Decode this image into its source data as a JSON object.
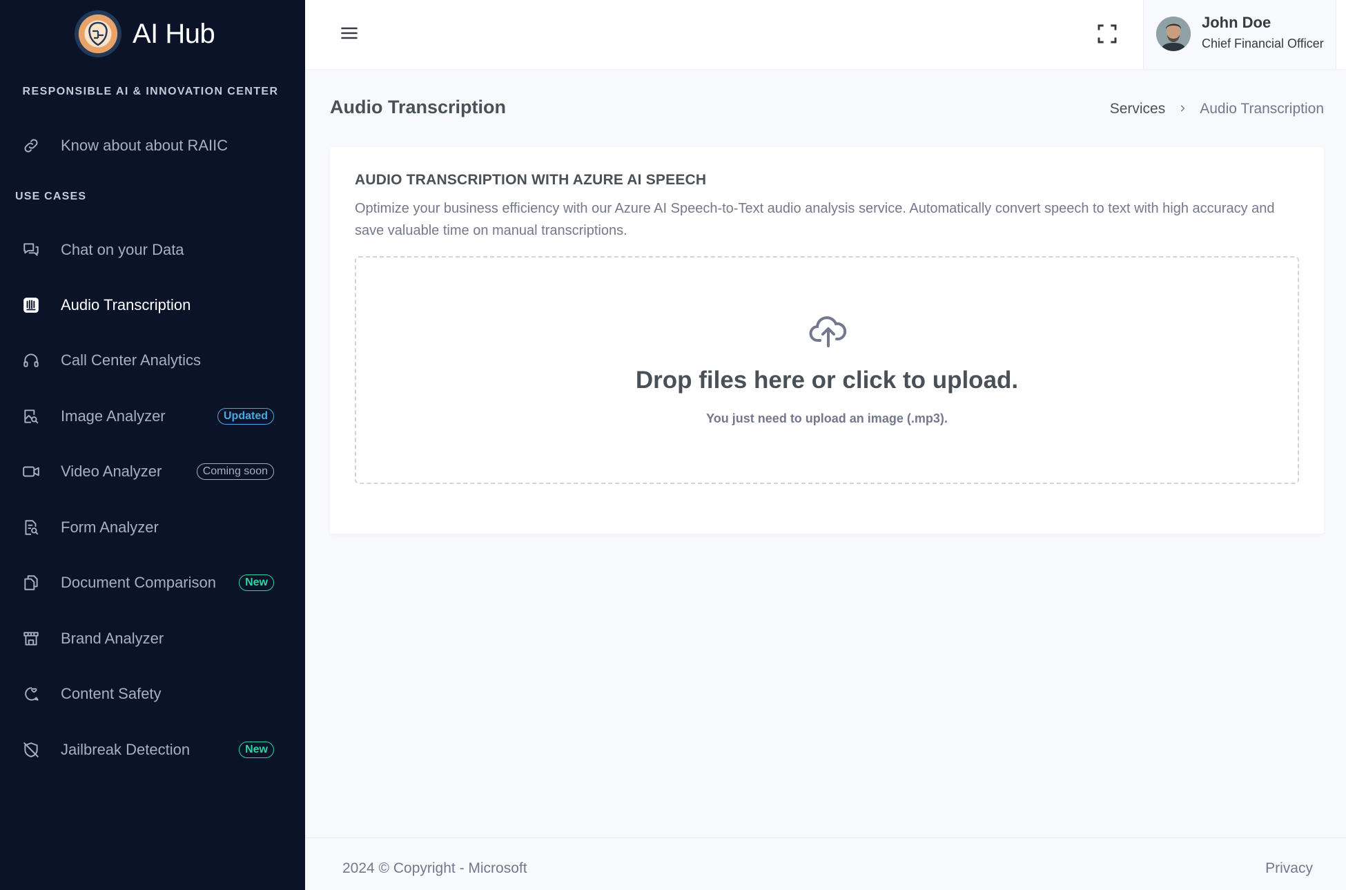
{
  "app": {
    "name": "AI Hub",
    "org_title": "RESPONSIBLE AI & INNOVATION CENTER"
  },
  "sidebar": {
    "about_link": {
      "label": "Know about about RAIIC",
      "icon": "link-icon"
    },
    "section_title": "USE CASES",
    "items": [
      {
        "label": "Chat on your Data",
        "icon": "chat-icon",
        "badge": ""
      },
      {
        "label": "Audio Transcription",
        "icon": "audio-icon",
        "badge": "",
        "active": true
      },
      {
        "label": "Call Center Analytics",
        "icon": "headset-icon",
        "badge": ""
      },
      {
        "label": "Image Analyzer",
        "icon": "image-search-icon",
        "badge": "Updated"
      },
      {
        "label": "Video Analyzer",
        "icon": "video-camera-icon",
        "badge": "Coming soon"
      },
      {
        "label": "Form Analyzer",
        "icon": "form-search-icon",
        "badge": ""
      },
      {
        "label": "Document Comparison",
        "icon": "documents-icon",
        "badge": "New"
      },
      {
        "label": "Brand Analyzer",
        "icon": "storefront-icon",
        "badge": ""
      },
      {
        "label": "Content Safety",
        "icon": "chat-heart-icon",
        "badge": ""
      },
      {
        "label": "Jailbreak Detection",
        "icon": "shield-off-icon",
        "badge": "New"
      }
    ]
  },
  "topbar": {
    "user": {
      "name": "John Doe",
      "role": "Chief Financial Officer"
    }
  },
  "page": {
    "title": "Audio Transcription",
    "breadcrumb": {
      "parent": "Services",
      "current": "Audio Transcription"
    }
  },
  "card": {
    "title": "AUDIO TRANSCRIPTION WITH AZURE AI SPEECH",
    "description": "Optimize your business efficiency with our Azure AI Speech-to-Text audio analysis service. Automatically convert speech to text with high accuracy and save valuable time on manual transcriptions.",
    "dropzone": {
      "title": "Drop files here or click to upload.",
      "subtitle": "You just need to upload an image (.mp3)."
    }
  },
  "footer": {
    "copyright": "2024 © Copyright - Microsoft",
    "privacy": "Privacy"
  },
  "colors": {
    "sidebar_bg": "#0b1329",
    "badge_updated": "#4aa8e0",
    "badge_new": "#2bd6a2",
    "text_dark": "#495057",
    "text_muted": "#74788d"
  }
}
